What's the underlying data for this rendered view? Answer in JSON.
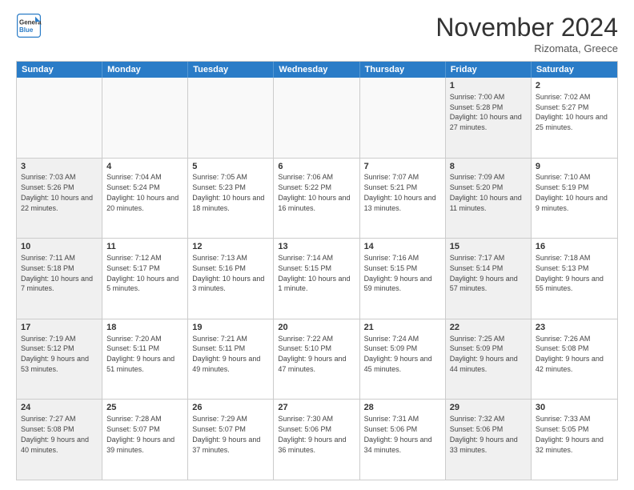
{
  "header": {
    "logo_line1": "General",
    "logo_line2": "Blue",
    "month": "November 2024",
    "location": "Rizomata, Greece"
  },
  "weekdays": [
    "Sunday",
    "Monday",
    "Tuesday",
    "Wednesday",
    "Thursday",
    "Friday",
    "Saturday"
  ],
  "rows": [
    [
      {
        "day": "",
        "text": "",
        "empty": true
      },
      {
        "day": "",
        "text": "",
        "empty": true
      },
      {
        "day": "",
        "text": "",
        "empty": true
      },
      {
        "day": "",
        "text": "",
        "empty": true
      },
      {
        "day": "",
        "text": "",
        "empty": true
      },
      {
        "day": "1",
        "text": "Sunrise: 7:00 AM\nSunset: 5:28 PM\nDaylight: 10 hours and 27 minutes.",
        "shaded": true
      },
      {
        "day": "2",
        "text": "Sunrise: 7:02 AM\nSunset: 5:27 PM\nDaylight: 10 hours and 25 minutes.",
        "shaded": false
      }
    ],
    [
      {
        "day": "3",
        "text": "Sunrise: 7:03 AM\nSunset: 5:26 PM\nDaylight: 10 hours and 22 minutes.",
        "shaded": true
      },
      {
        "day": "4",
        "text": "Sunrise: 7:04 AM\nSunset: 5:24 PM\nDaylight: 10 hours and 20 minutes.",
        "shaded": false
      },
      {
        "day": "5",
        "text": "Sunrise: 7:05 AM\nSunset: 5:23 PM\nDaylight: 10 hours and 18 minutes.",
        "shaded": false
      },
      {
        "day": "6",
        "text": "Sunrise: 7:06 AM\nSunset: 5:22 PM\nDaylight: 10 hours and 16 minutes.",
        "shaded": false
      },
      {
        "day": "7",
        "text": "Sunrise: 7:07 AM\nSunset: 5:21 PM\nDaylight: 10 hours and 13 minutes.",
        "shaded": false
      },
      {
        "day": "8",
        "text": "Sunrise: 7:09 AM\nSunset: 5:20 PM\nDaylight: 10 hours and 11 minutes.",
        "shaded": true
      },
      {
        "day": "9",
        "text": "Sunrise: 7:10 AM\nSunset: 5:19 PM\nDaylight: 10 hours and 9 minutes.",
        "shaded": false
      }
    ],
    [
      {
        "day": "10",
        "text": "Sunrise: 7:11 AM\nSunset: 5:18 PM\nDaylight: 10 hours and 7 minutes.",
        "shaded": true
      },
      {
        "day": "11",
        "text": "Sunrise: 7:12 AM\nSunset: 5:17 PM\nDaylight: 10 hours and 5 minutes.",
        "shaded": false
      },
      {
        "day": "12",
        "text": "Sunrise: 7:13 AM\nSunset: 5:16 PM\nDaylight: 10 hours and 3 minutes.",
        "shaded": false
      },
      {
        "day": "13",
        "text": "Sunrise: 7:14 AM\nSunset: 5:15 PM\nDaylight: 10 hours and 1 minute.",
        "shaded": false
      },
      {
        "day": "14",
        "text": "Sunrise: 7:16 AM\nSunset: 5:15 PM\nDaylight: 9 hours and 59 minutes.",
        "shaded": false
      },
      {
        "day": "15",
        "text": "Sunrise: 7:17 AM\nSunset: 5:14 PM\nDaylight: 9 hours and 57 minutes.",
        "shaded": true
      },
      {
        "day": "16",
        "text": "Sunrise: 7:18 AM\nSunset: 5:13 PM\nDaylight: 9 hours and 55 minutes.",
        "shaded": false
      }
    ],
    [
      {
        "day": "17",
        "text": "Sunrise: 7:19 AM\nSunset: 5:12 PM\nDaylight: 9 hours and 53 minutes.",
        "shaded": true
      },
      {
        "day": "18",
        "text": "Sunrise: 7:20 AM\nSunset: 5:11 PM\nDaylight: 9 hours and 51 minutes.",
        "shaded": false
      },
      {
        "day": "19",
        "text": "Sunrise: 7:21 AM\nSunset: 5:11 PM\nDaylight: 9 hours and 49 minutes.",
        "shaded": false
      },
      {
        "day": "20",
        "text": "Sunrise: 7:22 AM\nSunset: 5:10 PM\nDaylight: 9 hours and 47 minutes.",
        "shaded": false
      },
      {
        "day": "21",
        "text": "Sunrise: 7:24 AM\nSunset: 5:09 PM\nDaylight: 9 hours and 45 minutes.",
        "shaded": false
      },
      {
        "day": "22",
        "text": "Sunrise: 7:25 AM\nSunset: 5:09 PM\nDaylight: 9 hours and 44 minutes.",
        "shaded": true
      },
      {
        "day": "23",
        "text": "Sunrise: 7:26 AM\nSunset: 5:08 PM\nDaylight: 9 hours and 42 minutes.",
        "shaded": false
      }
    ],
    [
      {
        "day": "24",
        "text": "Sunrise: 7:27 AM\nSunset: 5:08 PM\nDaylight: 9 hours and 40 minutes.",
        "shaded": true
      },
      {
        "day": "25",
        "text": "Sunrise: 7:28 AM\nSunset: 5:07 PM\nDaylight: 9 hours and 39 minutes.",
        "shaded": false
      },
      {
        "day": "26",
        "text": "Sunrise: 7:29 AM\nSunset: 5:07 PM\nDaylight: 9 hours and 37 minutes.",
        "shaded": false
      },
      {
        "day": "27",
        "text": "Sunrise: 7:30 AM\nSunset: 5:06 PM\nDaylight: 9 hours and 36 minutes.",
        "shaded": false
      },
      {
        "day": "28",
        "text": "Sunrise: 7:31 AM\nSunset: 5:06 PM\nDaylight: 9 hours and 34 minutes.",
        "shaded": false
      },
      {
        "day": "29",
        "text": "Sunrise: 7:32 AM\nSunset: 5:06 PM\nDaylight: 9 hours and 33 minutes.",
        "shaded": true
      },
      {
        "day": "30",
        "text": "Sunrise: 7:33 AM\nSunset: 5:05 PM\nDaylight: 9 hours and 32 minutes.",
        "shaded": false
      }
    ]
  ]
}
